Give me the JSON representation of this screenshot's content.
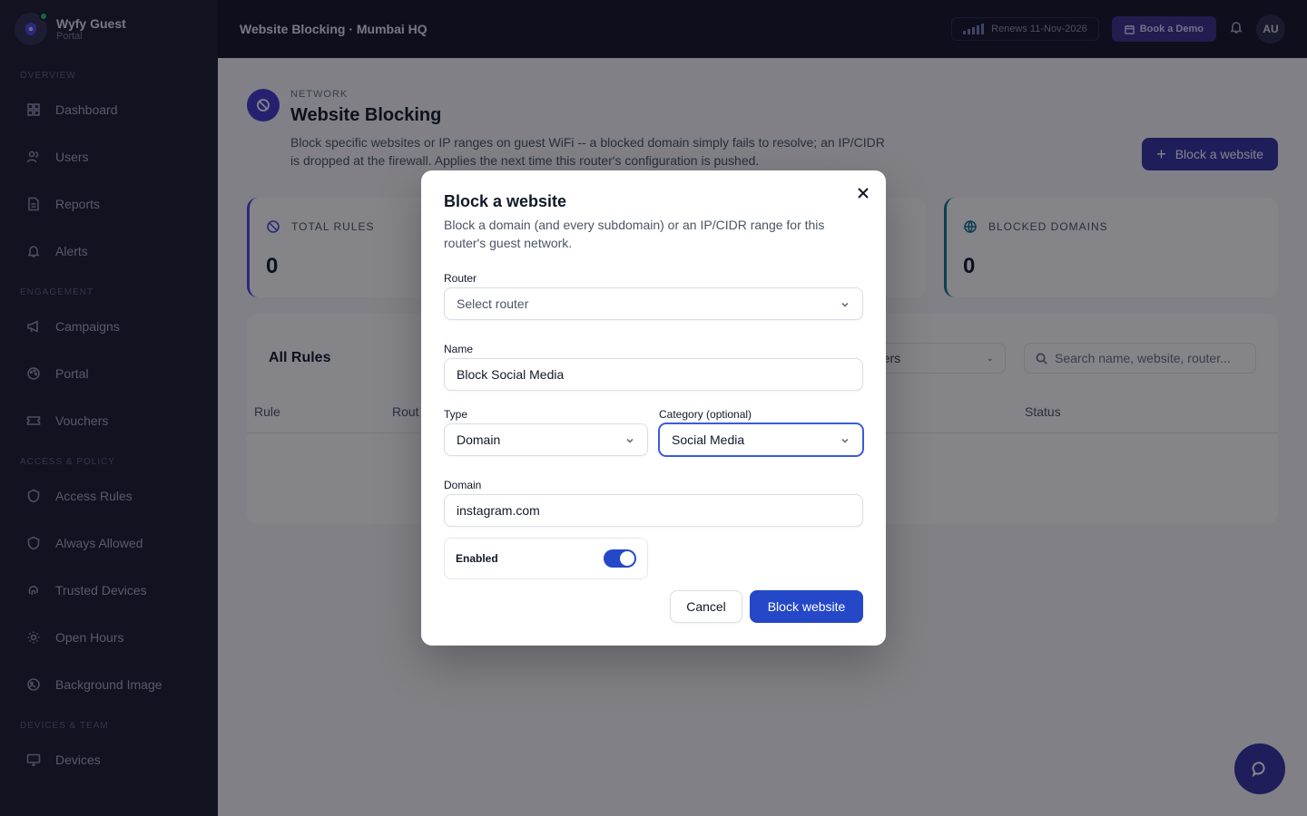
{
  "brand": {
    "name": "Wyfy Guest",
    "subtitle": "Portal"
  },
  "topbar": {
    "title": "Website Blocking · Mumbai HQ",
    "renewal": "Renews 11-Nov-2026",
    "demo_label": "Book a Demo",
    "avatar_initials": "AU"
  },
  "sidebar": {
    "sections": [
      {
        "label": "OVERVIEW",
        "items": [
          {
            "label": "Dashboard",
            "icon": "grid-icon"
          },
          {
            "label": "Users",
            "icon": "users-icon"
          },
          {
            "label": "Reports",
            "icon": "file-icon"
          },
          {
            "label": "Alerts",
            "icon": "bell-icon"
          }
        ]
      },
      {
        "label": "ENGAGEMENT",
        "items": [
          {
            "label": "Campaigns",
            "icon": "megaphone-icon"
          },
          {
            "label": "Portal",
            "icon": "palette-icon"
          },
          {
            "label": "Vouchers",
            "icon": "ticket-icon"
          }
        ]
      },
      {
        "label": "ACCESS & POLICY",
        "items": [
          {
            "label": "Access Rules",
            "icon": "shield-icon"
          },
          {
            "label": "Always Allowed",
            "icon": "shield-check-icon"
          },
          {
            "label": "Trusted Devices",
            "icon": "fingerprint-icon"
          },
          {
            "label": "Open Hours",
            "icon": "sun-icon"
          },
          {
            "label": "Background Image",
            "icon": "image-icon"
          }
        ]
      },
      {
        "label": "DEVICES & TEAM",
        "items": [
          {
            "label": "Devices",
            "icon": "monitor-icon"
          }
        ]
      }
    ]
  },
  "page": {
    "eyebrow": "NETWORK",
    "title": "Website Blocking",
    "description": "Block specific websites or IP ranges on guest WiFi -- a blocked domain simply fails to resolve; an IP/CIDR is dropped at the firewall. Applies the next time this router's configuration is pushed.",
    "primary_action": "Block a website"
  },
  "stats": [
    {
      "label": "TOTAL RULES",
      "value": "0",
      "color": "#4f46e5"
    },
    {
      "label": "BLOCKED DOMAINS",
      "value": "0",
      "color": "#0e7490"
    }
  ],
  "rules": {
    "title": "All Rules",
    "router_filter": "uters",
    "search_placeholder": "Search name, website, router...",
    "columns": [
      "Rule",
      "Rout",
      "Status"
    ]
  },
  "modal": {
    "title": "Block a website",
    "subtitle": "Block a domain (and every subdomain) or an IP/CIDR range for this router's guest network.",
    "router_label": "Router",
    "router_value": "Select router",
    "name_label": "Name",
    "name_value": "Block Social Media",
    "type_label": "Type",
    "type_value": "Domain",
    "category_label": "Category (optional)",
    "category_value": "Social Media",
    "domain_label": "Domain",
    "domain_value": "instagram.com",
    "enabled_label": "Enabled",
    "enabled": true,
    "cancel_label": "Cancel",
    "submit_label": "Block website"
  }
}
